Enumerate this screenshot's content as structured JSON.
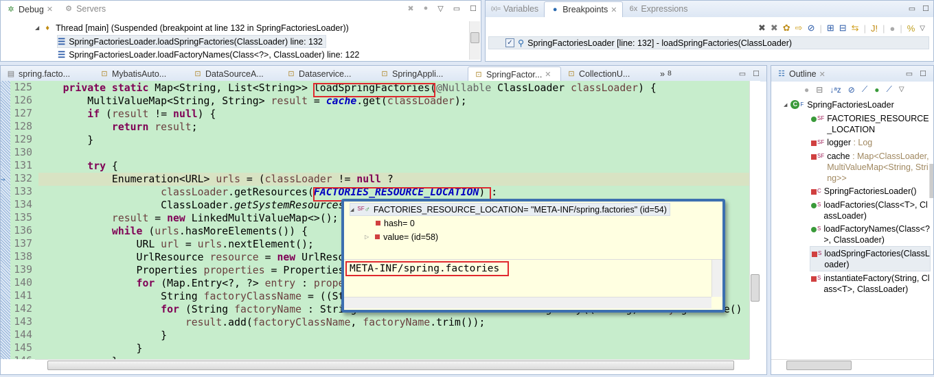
{
  "debug": {
    "tabs": [
      {
        "label": "Debug",
        "active": true
      },
      {
        "label": "Servers",
        "active": false
      }
    ],
    "thread": "Thread [main] (Suspended (breakpoint at line 132 in SpringFactoriesLoader))",
    "frames": [
      "SpringFactoriesLoader.loadSpringFactories(ClassLoader) line: 132",
      "SpringFactoriesLoader.loadFactoryNames(Class<?>, ClassLoader) line: 122"
    ]
  },
  "breakpoints": {
    "tabs": [
      {
        "label": "Variables",
        "active": false
      },
      {
        "label": "Breakpoints",
        "active": true
      },
      {
        "label": "Expressions",
        "active": false
      }
    ],
    "items": [
      {
        "label": "SpringFactoriesLoader [line: 132] - loadSpringFactories(ClassLoader)",
        "checked": true
      }
    ]
  },
  "editor": {
    "tabs": [
      "spring.facto...",
      "MybatisAuto...",
      "DataSourceA...",
      "Dataservice...",
      "SpringAppli...",
      "SpringFactor...",
      "CollectionU..."
    ],
    "active_tab": 5,
    "overflow": "8",
    "current_line": 132,
    "lines": [
      {
        "n": "125",
        "s": [
          [
            "",
            "    "
          ],
          [
            "k",
            "private static "
          ],
          [
            "",
            "Map<String, List<String>> loadSpringFactories("
          ],
          [
            "a",
            "@Nullable "
          ],
          [
            "",
            "ClassLoader "
          ],
          [
            "v",
            "classLoader"
          ],
          [
            "",
            ") {"
          ]
        ]
      },
      {
        "n": "126",
        "s": [
          [
            "",
            "        MultiValueMap<String, String> "
          ],
          [
            "v",
            "result"
          ],
          [
            "",
            " = "
          ],
          [
            "f",
            "cache"
          ],
          [
            "",
            ".get("
          ],
          [
            "v",
            "classLoader"
          ],
          [
            "",
            ");"
          ]
        ]
      },
      {
        "n": "127",
        "s": [
          [
            "",
            "        "
          ],
          [
            "k",
            "if"
          ],
          [
            "",
            " ("
          ],
          [
            "v",
            "result"
          ],
          [
            "",
            " != "
          ],
          [
            "k",
            "null"
          ],
          [
            "",
            ") {"
          ]
        ]
      },
      {
        "n": "128",
        "s": [
          [
            "",
            "            "
          ],
          [
            "k",
            "return "
          ],
          [
            "v",
            "result"
          ],
          [
            "",
            ";"
          ]
        ]
      },
      {
        "n": "129",
        "s": [
          [
            "",
            "        }"
          ]
        ]
      },
      {
        "n": "130",
        "s": [
          [
            "",
            ""
          ]
        ]
      },
      {
        "n": "131",
        "s": [
          [
            "",
            "        "
          ],
          [
            "k",
            "try"
          ],
          [
            "",
            " {"
          ]
        ]
      },
      {
        "n": "132",
        "s": [
          [
            "",
            "            Enumeration<URL> "
          ],
          [
            "v",
            "urls"
          ],
          [
            "",
            " = ("
          ],
          [
            "v",
            "classLoader"
          ],
          [
            "",
            " != "
          ],
          [
            "k",
            "null"
          ],
          [
            "",
            " ?"
          ]
        ]
      },
      {
        "n": "133",
        "s": [
          [
            "",
            "                    "
          ],
          [
            "v",
            "classLoader"
          ],
          [
            "",
            ".getResources("
          ],
          [
            "f",
            "FACTORIES_RESOURCE_LOCATION"
          ],
          [
            "",
            ") :"
          ]
        ]
      },
      {
        "n": "134",
        "s": [
          [
            "",
            "                    ClassLoader."
          ],
          [
            "i",
            "getSystemResources"
          ],
          [
            "",
            "("
          ],
          [
            "f",
            "FACTORIES_RESOURCE_LOCATION"
          ],
          [
            "",
            "));"
          ]
        ]
      },
      {
        "n": "135",
        "s": [
          [
            "",
            "            "
          ],
          [
            "v",
            "result"
          ],
          [
            "",
            " = "
          ],
          [
            "k",
            "new"
          ],
          [
            "",
            " LinkedMultiValueMap<>();"
          ]
        ]
      },
      {
        "n": "136",
        "s": [
          [
            "",
            "            "
          ],
          [
            "k",
            "while"
          ],
          [
            "",
            " ("
          ],
          [
            "v",
            "urls"
          ],
          [
            "",
            ".hasMoreElements()) {"
          ]
        ]
      },
      {
        "n": "137",
        "s": [
          [
            "",
            "                URL "
          ],
          [
            "v",
            "url"
          ],
          [
            "",
            " = "
          ],
          [
            "v",
            "urls"
          ],
          [
            "",
            ".nextElement();"
          ]
        ]
      },
      {
        "n": "138",
        "s": [
          [
            "",
            "                UrlResource "
          ],
          [
            "v",
            "resource"
          ],
          [
            "",
            " = "
          ],
          [
            "k",
            "new"
          ],
          [
            "",
            " UrlResource("
          ],
          [
            "v",
            "url"
          ],
          [
            "",
            ");"
          ]
        ]
      },
      {
        "n": "139",
        "s": [
          [
            "",
            "                Properties "
          ],
          [
            "v",
            "properties"
          ],
          [
            "",
            " = PropertiesLoaderUtils."
          ],
          [
            "i",
            "loadProperties"
          ],
          [
            "",
            "("
          ],
          [
            "v",
            "resource"
          ],
          [
            "",
            ");"
          ]
        ]
      },
      {
        "n": "140",
        "s": [
          [
            "",
            "                "
          ],
          [
            "k",
            "for"
          ],
          [
            "",
            " (Map.Entry<?, ?> "
          ],
          [
            "v",
            "entry"
          ],
          [
            "",
            " : "
          ],
          [
            "v",
            "properties"
          ],
          [
            "",
            ".entrySet()) {"
          ]
        ]
      },
      {
        "n": "141",
        "s": [
          [
            "",
            "                    String "
          ],
          [
            "v",
            "factoryClassName"
          ],
          [
            "",
            " = ((String) "
          ],
          [
            "v",
            "entry"
          ],
          [
            "",
            ".getKey()).trim();"
          ]
        ]
      },
      {
        "n": "142",
        "s": [
          [
            "",
            "                    "
          ],
          [
            "k",
            "for"
          ],
          [
            "",
            " (String "
          ],
          [
            "v",
            "factoryName"
          ],
          [
            "",
            " : StringUtils."
          ],
          [
            "i",
            "commaDelimitedListToStringArray"
          ],
          [
            "",
            "((String) "
          ],
          [
            "v",
            "entry"
          ],
          [
            "",
            ".getValue()"
          ]
        ]
      },
      {
        "n": "143",
        "s": [
          [
            "",
            "                        "
          ],
          [
            "v",
            "result"
          ],
          [
            "",
            ".add("
          ],
          [
            "v",
            "factoryClassName"
          ],
          [
            ", ",
            ""
          ],
          [
            "v",
            "factoryName"
          ],
          [
            "",
            ".trim());"
          ]
        ]
      },
      {
        "n": "144",
        "s": [
          [
            "",
            "                    }"
          ]
        ]
      },
      {
        "n": "145",
        "s": [
          [
            "",
            "                }"
          ]
        ]
      },
      {
        "n": "146",
        "s": [
          [
            "",
            "            }"
          ]
        ]
      }
    ]
  },
  "hover": {
    "root": "FACTORIES_RESOURCE_LOCATION= \"META-INF/spring.factories\" (id=54)",
    "children": [
      "hash= 0",
      "value= (id=58)"
    ],
    "detail": "META-INF/spring.factories"
  },
  "outline": {
    "title": "Outline",
    "class": "SpringFactoriesLoader",
    "members": [
      {
        "name": "FACTORIES_RESOURCE_LOCATION",
        "type": "",
        "mods": "SF",
        "vis": "public"
      },
      {
        "name": "logger",
        "type": " : Log",
        "mods": "SF",
        "vis": "private"
      },
      {
        "name": "cache",
        "type": " : Map<ClassLoader, MultiValueMap<String, String>>",
        "mods": "SF",
        "vis": "private"
      },
      {
        "name": "SpringFactoriesLoader()",
        "type": "",
        "mods": "C",
        "vis": "private"
      },
      {
        "name": "loadFactories(Class<T>, ClassLoader)",
        "type": "",
        "mods": "S",
        "vis": "public"
      },
      {
        "name": "loadFactoryNames(Class<?>, ClassLoader)",
        "type": "",
        "mods": "S",
        "vis": "public"
      },
      {
        "name": "loadSpringFactories(ClassLoader)",
        "type": "",
        "mods": "S",
        "vis": "private",
        "selected": true
      },
      {
        "name": "instantiateFactory(String, Class<T>, ClassLoader)",
        "type": "",
        "mods": "S",
        "vis": "private"
      }
    ]
  },
  "colors": {
    "editor_bg": "#c7edcc",
    "highlight": "#e0282e",
    "popup_border": "#3c6fb0",
    "keyword": "#7f0055",
    "field": "#0000c0"
  }
}
